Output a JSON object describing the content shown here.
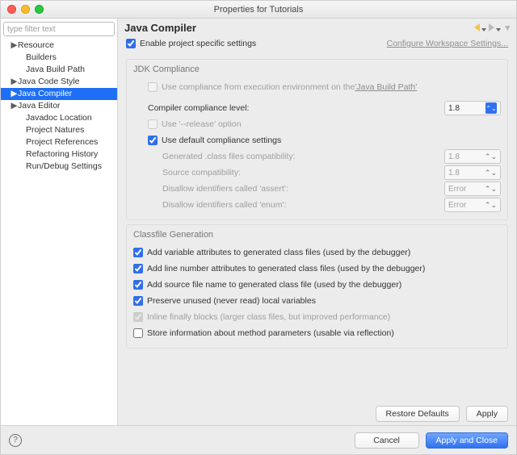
{
  "window": {
    "title": "Properties for Tutorials"
  },
  "sidebar": {
    "filter_placeholder": "type filter text",
    "items": [
      {
        "label": "Resource",
        "arrow": true,
        "indent": 0,
        "sel": false
      },
      {
        "label": "Builders",
        "arrow": false,
        "indent": 1,
        "sel": false
      },
      {
        "label": "Java Build Path",
        "arrow": false,
        "indent": 1,
        "sel": false
      },
      {
        "label": "Java Code Style",
        "arrow": true,
        "indent": 0,
        "sel": false
      },
      {
        "label": "Java Compiler",
        "arrow": true,
        "indent": 0,
        "sel": true
      },
      {
        "label": "Java Editor",
        "arrow": true,
        "indent": 0,
        "sel": false
      },
      {
        "label": "Javadoc Location",
        "arrow": false,
        "indent": 1,
        "sel": false
      },
      {
        "label": "Project Natures",
        "arrow": false,
        "indent": 1,
        "sel": false
      },
      {
        "label": "Project References",
        "arrow": false,
        "indent": 1,
        "sel": false
      },
      {
        "label": "Refactoring History",
        "arrow": false,
        "indent": 1,
        "sel": false
      },
      {
        "label": "Run/Debug Settings",
        "arrow": false,
        "indent": 1,
        "sel": false
      }
    ]
  },
  "header": {
    "title": "Java Compiler"
  },
  "top": {
    "enable_specific": "Enable project specific settings",
    "workspace_link": "Configure Workspace Settings..."
  },
  "jdk": {
    "title": "JDK Compliance",
    "use_exec_env": "Use compliance from execution environment on the ",
    "build_path_link": "'Java Build Path'",
    "compliance_label": "Compiler compliance level:",
    "compliance_value": "1.8",
    "release_option": "Use '--release' option",
    "use_default": "Use default compliance settings",
    "gen_compat_label": "Generated .class files compatibility:",
    "gen_compat_value": "1.8",
    "src_compat_label": "Source compatibility:",
    "src_compat_value": "1.8",
    "disallow_assert_label": "Disallow identifiers called 'assert':",
    "disallow_assert_value": "Error",
    "disallow_enum_label": "Disallow identifiers called 'enum':",
    "disallow_enum_value": "Error"
  },
  "classfile": {
    "title": "Classfile Generation",
    "add_var": "Add variable attributes to generated class files (used by the debugger)",
    "add_line": "Add line number attributes to generated class files (used by the debugger)",
    "add_src": "Add source file name to generated class file (used by the debugger)",
    "preserve": "Preserve unused (never read) local variables",
    "inline": "Inline finally blocks (larger class files, but improved performance)",
    "store": "Store information about method parameters (usable via reflection)"
  },
  "buttons": {
    "restore": "Restore Defaults",
    "apply": "Apply",
    "cancel": "Cancel",
    "apply_close": "Apply and Close"
  }
}
